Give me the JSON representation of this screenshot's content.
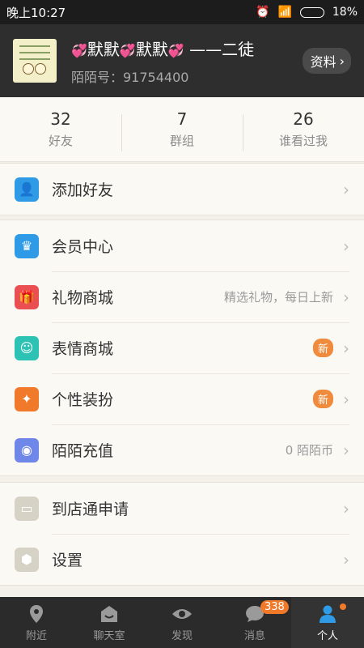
{
  "status_bar": {
    "time": "晚上10:27",
    "battery": "18%",
    "battery_level": 0.18
  },
  "profile": {
    "name_part1": "默默",
    "name_part2": "默默",
    "name_part3": "——二徒",
    "hearts": "💞",
    "id_text": "陌陌号：91754400",
    "info_button": "资料"
  },
  "stats": [
    {
      "num": "32",
      "label": "好友"
    },
    {
      "num": "7",
      "label": "群组"
    },
    {
      "num": "26",
      "label": "谁看过我"
    }
  ],
  "menu": {
    "add_friend": {
      "label": "添加好友",
      "icon": "add-user-icon",
      "color": "#2f9be6"
    },
    "vip": {
      "label": "会员中心",
      "icon": "crown-icon",
      "color": "#2f9be6"
    },
    "gift": {
      "label": "礼物商城",
      "value": "精选礼物，每日上新",
      "icon": "gift-icon",
      "color": "#ea4f52"
    },
    "emoji": {
      "label": "表情商城",
      "badge": "新",
      "icon": "emoji-icon",
      "color": "#2cc3b5"
    },
    "dress": {
      "label": "个性装扮",
      "badge": "新",
      "icon": "wand-icon",
      "color": "#f07a2a"
    },
    "recharge": {
      "label": "陌陌充值",
      "value": "0 陌陌币",
      "icon": "coin-icon",
      "color": "#6f87e8"
    },
    "store": {
      "label": "到店通申请",
      "icon": "store-icon",
      "color": "#d6d3c6"
    },
    "settings": {
      "label": "设置",
      "icon": "gear-icon",
      "color": "#d6d3c6"
    }
  },
  "tabs": [
    {
      "label": "附近",
      "icon": "location-icon"
    },
    {
      "label": "聊天室",
      "icon": "chatroom-icon"
    },
    {
      "label": "发现",
      "icon": "eye-icon"
    },
    {
      "label": "消息",
      "icon": "message-icon",
      "badge": "338"
    },
    {
      "label": "个人",
      "icon": "person-icon",
      "active": true
    }
  ]
}
